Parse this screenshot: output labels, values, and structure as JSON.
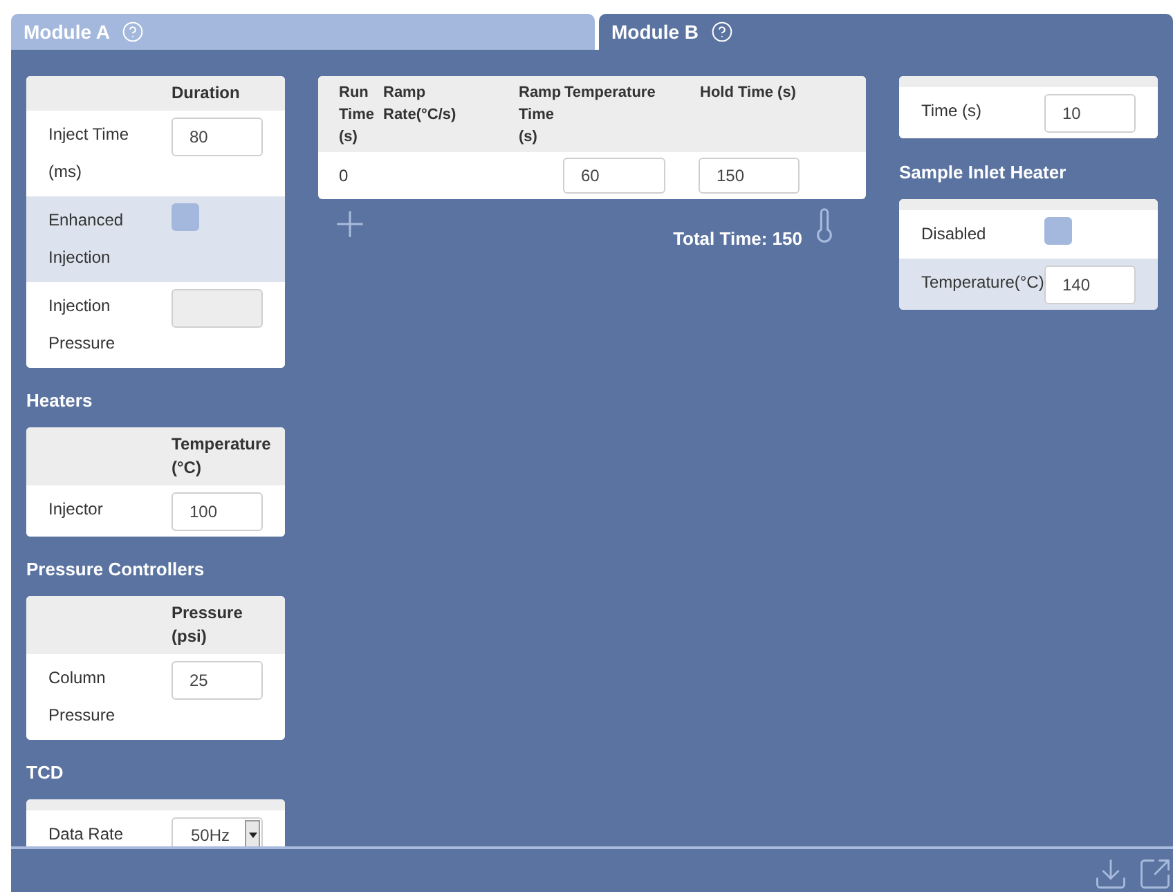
{
  "tabs": [
    {
      "label": "Module A",
      "selected": false
    },
    {
      "label": "Module B",
      "selected": true
    }
  ],
  "left_sections": [
    {
      "header": "Duration",
      "rows": [
        {
          "label": "Inject Time (ms)",
          "kind": "input",
          "value": "80",
          "disabled": false,
          "highlighted": false
        },
        {
          "label": "Enhanced Injection",
          "kind": "checkbox",
          "checked": false,
          "highlighted": true
        },
        {
          "label": "Injection Pressure",
          "kind": "input",
          "value": "",
          "disabled": true,
          "highlighted": false
        }
      ]
    },
    {
      "title": "Heaters",
      "header": "Temperature (°C)",
      "rows": [
        {
          "label": "Injector",
          "kind": "input",
          "value": "100",
          "disabled": false,
          "highlighted": false
        }
      ]
    },
    {
      "title": "Pressure Controllers",
      "header": "Pressure (psi)",
      "rows": [
        {
          "label": "Column Pressure",
          "kind": "input",
          "value": "25",
          "disabled": false,
          "highlighted": false
        }
      ]
    },
    {
      "title": "TCD",
      "rows": [
        {
          "label": "Data Rate",
          "kind": "select",
          "value": "50Hz",
          "highlighted": false
        }
      ]
    }
  ],
  "temperature_profile": {
    "columns": [
      "Run Time (s)",
      "Ramp Rate(°C/s)",
      "Ramp Time (s)",
      "Temperature",
      "Hold Time (s)"
    ],
    "rows": [
      {
        "run_time": "0",
        "temperature": "60",
        "hold_time": "150"
      }
    ],
    "total_time": "Total Time: 150"
  },
  "right_sections": [
    {
      "rows": [
        {
          "label": "Time (s)",
          "kind": "input",
          "value": "10",
          "disabled": false,
          "highlighted": false
        }
      ]
    },
    {
      "title": "Sample Inlet Heater",
      "rows": [
        {
          "label": "Disabled",
          "kind": "checkbox",
          "checked": false,
          "highlighted": false
        },
        {
          "label": "Temperature(°C)",
          "kind": "input",
          "value": "140",
          "disabled": false,
          "highlighted": true
        }
      ]
    }
  ]
}
